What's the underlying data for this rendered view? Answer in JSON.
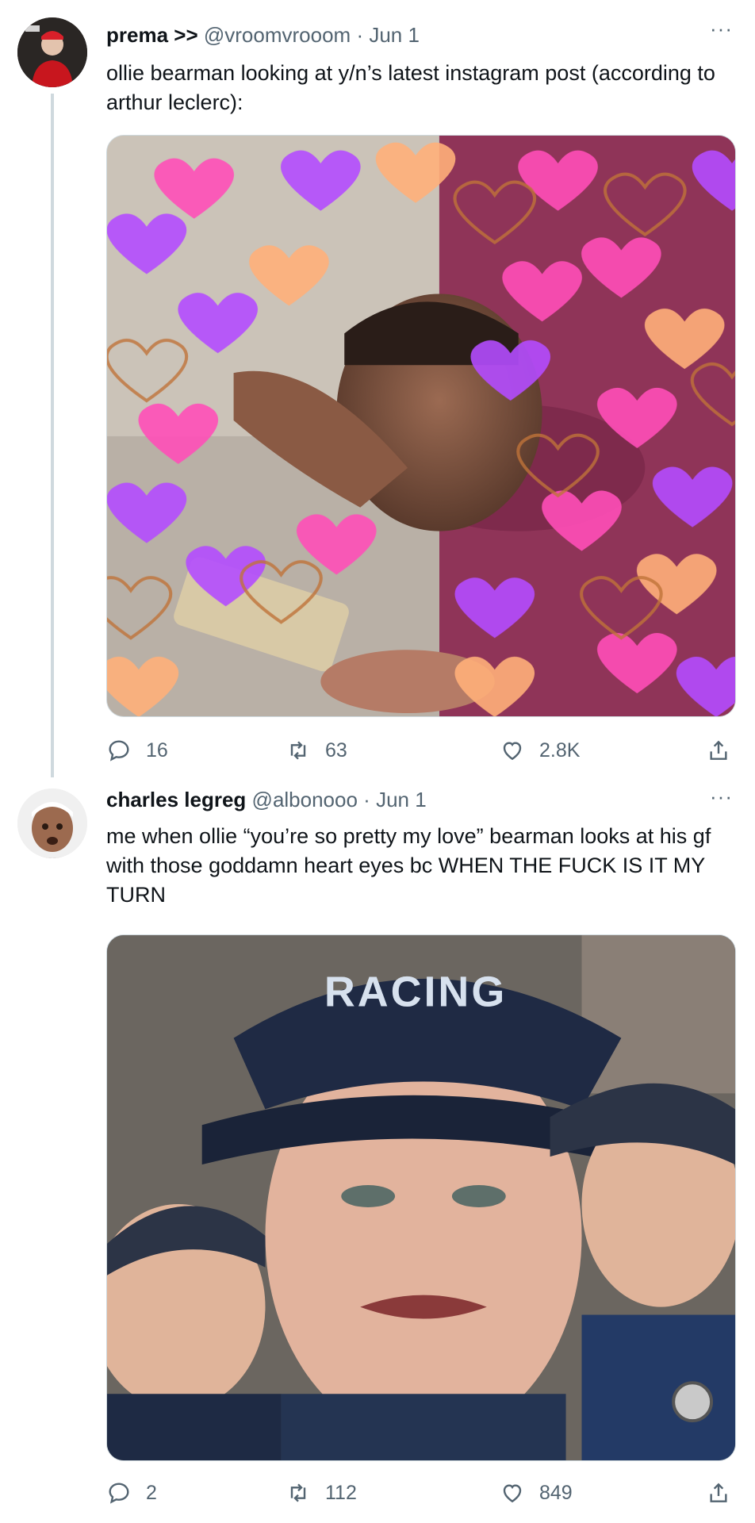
{
  "tweets": [
    {
      "name": "prema >>",
      "handle": "@vroomvrooom",
      "separator": "·",
      "date": "Jun 1",
      "text": "ollie bearman looking at y/n’s latest instagram post (according to arthur leclerc):",
      "media_description": "meme image: man resting head on hand looking at phone surrounded by heart emojis",
      "stats": {
        "replies": "16",
        "retweets": "63",
        "likes": "2.8K"
      },
      "more": "···"
    },
    {
      "name": "charles legreg",
      "handle": "@albonooo",
      "separator": "·",
      "date": "Jun 1",
      "text": "me when ollie “you’re so pretty my love” bearman looks at his gf with those goddamn heart eyes bc WHEN THE FUCK IS IT MY TURN",
      "media_text": "RACING",
      "media_description": "collage of a crying driver in a Williams Racing cap",
      "stats": {
        "replies": "2",
        "retweets": "112",
        "likes": "849"
      },
      "more": "···"
    }
  ],
  "icons": {
    "reply": "speech-bubble-icon",
    "retweet": "retweet-arrows-icon",
    "like": "heart-icon",
    "share": "share-upload-icon"
  },
  "colors": {
    "text": "#0f1419",
    "secondary": "#536471",
    "border": "#cfd9de",
    "heart_pink": "#ff4fb8",
    "heart_purple": "#b44cff",
    "heart_orange": "#ffb07a"
  }
}
